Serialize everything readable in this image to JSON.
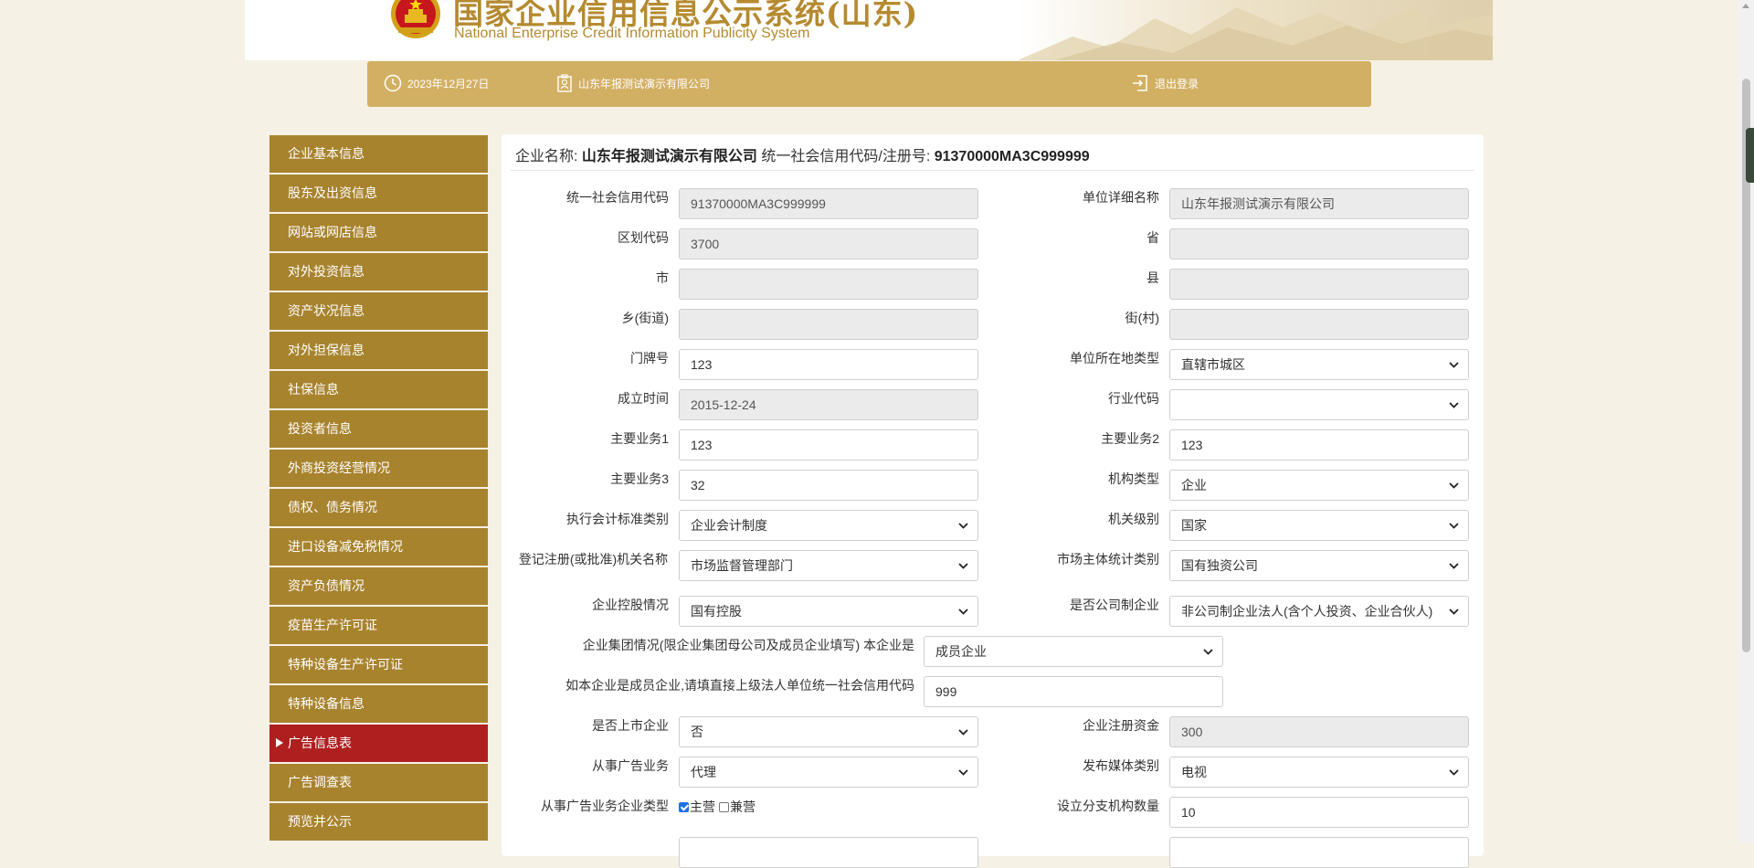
{
  "header": {
    "title": "国家企业信用信息公示系统(山东)",
    "subtitle": "National Enterprise Credit Information Publicity System"
  },
  "infobar": {
    "date": "2023年12月27日",
    "company": "山东年报测试演示有限公司",
    "logout": "退出登录"
  },
  "sidebar": {
    "items": [
      {
        "label": "企业基本信息",
        "active": false
      },
      {
        "label": "股东及出资信息",
        "active": false
      },
      {
        "label": "网站或网店信息",
        "active": false
      },
      {
        "label": "对外投资信息",
        "active": false
      },
      {
        "label": "资产状况信息",
        "active": false
      },
      {
        "label": "对外担保信息",
        "active": false
      },
      {
        "label": "社保信息",
        "active": false
      },
      {
        "label": "投资者信息",
        "active": false
      },
      {
        "label": "外商投资经营情况",
        "active": false
      },
      {
        "label": "债权、债务情况",
        "active": false
      },
      {
        "label": "进口设备减免税情况",
        "active": false
      },
      {
        "label": "资产负债情况",
        "active": false
      },
      {
        "label": "疫苗生产许可证",
        "active": false
      },
      {
        "label": "特种设备生产许可证",
        "active": false
      },
      {
        "label": "特种设备信息",
        "active": false
      },
      {
        "label": "广告信息表",
        "active": true
      },
      {
        "label": "广告调查表",
        "active": false
      },
      {
        "label": "预览并公示",
        "active": false
      }
    ]
  },
  "main": {
    "company_name_label": "企业名称:",
    "company_name": "山东年报测试演示有限公司",
    "credit_code_label": "统一社会信用代码/注册号:",
    "credit_code": "91370000MA3C999999",
    "form": {
      "credit_code": {
        "label": "统一社会信用代码",
        "value": "91370000MA3C999999"
      },
      "unit_name": {
        "label": "单位详细名称",
        "value": "山东年报测试演示有限公司"
      },
      "region_code": {
        "label": "区划代码",
        "value": "3700"
      },
      "province": {
        "label": "省",
        "value": ""
      },
      "city": {
        "label": "市",
        "value": ""
      },
      "county": {
        "label": "县",
        "value": ""
      },
      "township": {
        "label": "乡(街道)",
        "value": ""
      },
      "street": {
        "label": "街(村)",
        "value": ""
      },
      "house_no": {
        "label": "门牌号",
        "value": "123"
      },
      "location_type": {
        "label": "单位所在地类型",
        "value": "直辖市城区"
      },
      "found_date": {
        "label": "成立时间",
        "value": "2015-12-24"
      },
      "industry_code": {
        "label": "行业代码",
        "value": ""
      },
      "business1": {
        "label": "主要业务1",
        "value": "123"
      },
      "business2": {
        "label": "主要业务2",
        "value": "123"
      },
      "business3": {
        "label": "主要业务3",
        "value": "32"
      },
      "org_type": {
        "label": "机构类型",
        "value": "企业"
      },
      "accounting": {
        "label": "执行会计标准类别",
        "value": "企业会计制度"
      },
      "org_level": {
        "label": "机关级别",
        "value": "国家"
      },
      "reg_authority": {
        "label": "登记注册(或批准)机关名称",
        "value": "市场监督管理部门"
      },
      "market_stat": {
        "label": "市场主体统计类别",
        "value": "国有独资公司"
      },
      "holding": {
        "label": "企业控股情况",
        "value": "国有控股"
      },
      "is_company": {
        "label": "是否公司制企业",
        "value": "非公司制企业法人(含个人投资、企业合伙人)"
      },
      "group": {
        "label": "企业集团情况(限企业集团母公司及成员企业填写) 本企业是",
        "value": "成员企业"
      },
      "parent_code": {
        "label": "如本企业是成员企业,请填直接上级法人单位统一社会信用代码",
        "value": "999"
      },
      "listed": {
        "label": "是否上市企业",
        "value": "否"
      },
      "reg_capital": {
        "label": "企业注册资金",
        "value": "300"
      },
      "ad_business": {
        "label": "从事广告业务",
        "value": "代理"
      },
      "media_type": {
        "label": "发布媒体类别",
        "value": "电视"
      },
      "ad_company_type": {
        "label": "从事广告业务企业类型",
        "option1": "主营",
        "option1_checked": true,
        "option2": "兼营",
        "option2_checked": false
      },
      "branch_count": {
        "label": "设立分支机构数量",
        "value": "10"
      }
    }
  }
}
